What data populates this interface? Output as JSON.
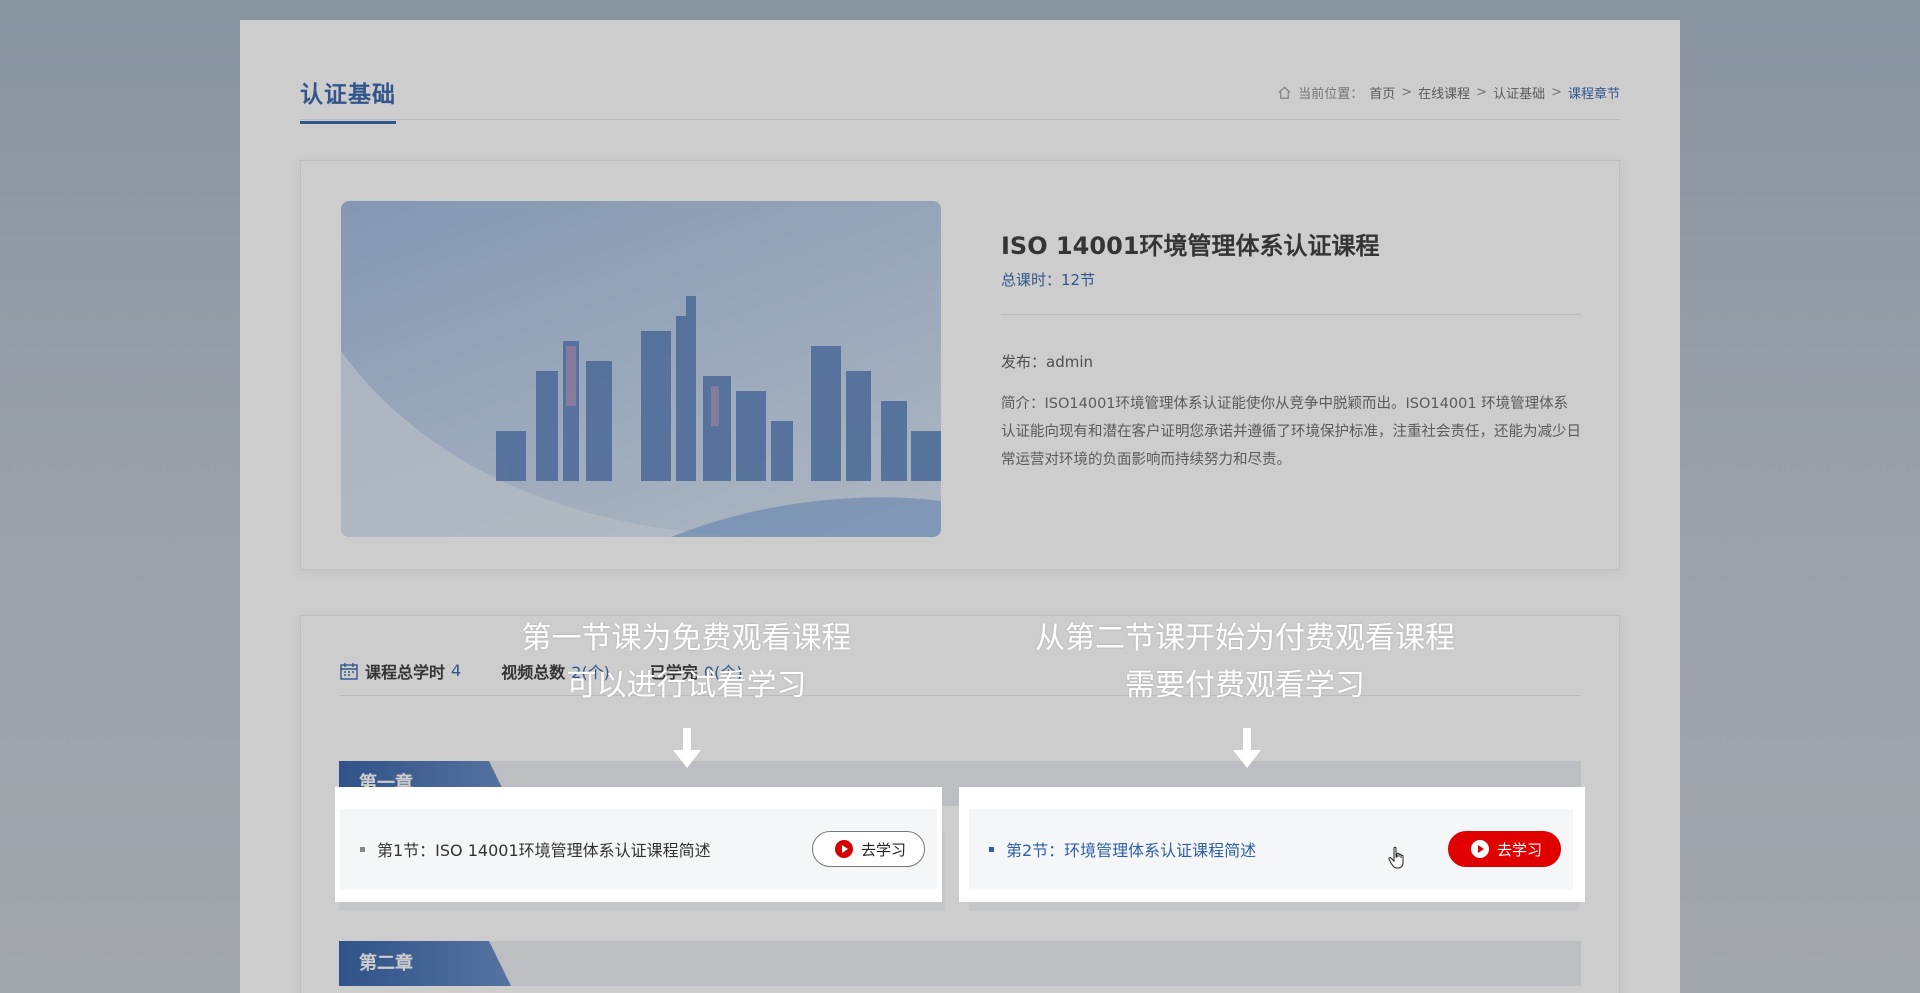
{
  "header": {
    "page_title": "认证基础",
    "breadcrumb": {
      "prefix": "当前位置：",
      "items": [
        "首页",
        "在线课程",
        "认证基础"
      ],
      "separator": ">",
      "current": "课程章节"
    }
  },
  "course": {
    "name": "ISO 14001环境管理体系认证课程",
    "total_hours": "总课时：12节",
    "publisher_label": "发布：",
    "publisher": "admin",
    "intro_label": "简介：",
    "intro": "ISO14001环境管理体系认证能使你从竞争中脱颖而出。ISO14001 环境管理体系认证能向现有和潜在客户证明您承诺并遵循了环境保护标准，注重社会责任，还能为减少日常运营对环境的负面影响而持续努力和尽责。"
  },
  "stats": {
    "total_hours_label": "课程总学时",
    "total_hours_value": "4",
    "video_count_label": "视频总数",
    "video_count_value": "2(个)",
    "completed_label": "已学完",
    "completed_value": "0(个)"
  },
  "chapters": [
    {
      "title": "第一章"
    },
    {
      "title": "第二章"
    }
  ],
  "lessons": [
    {
      "title": "第1节：ISO 14001环境管理体系认证课程简述",
      "button": "去学习"
    },
    {
      "title": "第2节：环境管理体系认证课程简述",
      "button": "去学习"
    }
  ],
  "annotations": {
    "free_line1": "第一节课为免费观看课程",
    "free_line2": "可以进行试看学习",
    "paid_line1": "从第二节课开始为付费观看课程",
    "paid_line2": "需要付费观看学习"
  },
  "colors": {
    "accent": "#2f5fa8",
    "button_red": "#e00000"
  }
}
